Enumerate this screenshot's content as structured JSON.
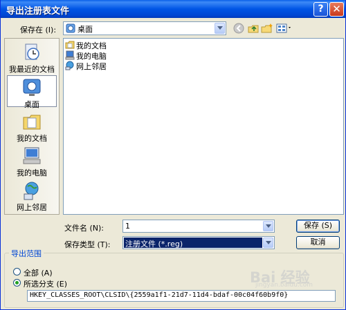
{
  "window": {
    "title": "导出注册表文件"
  },
  "look_in": {
    "label": "保存在 (I):",
    "value": "桌面"
  },
  "places": [
    {
      "label": "我最近的文档",
      "icon": "recent-documents-icon"
    },
    {
      "label": "桌面",
      "icon": "desktop-icon",
      "selected": true
    },
    {
      "label": "我的文档",
      "icon": "my-documents-icon"
    },
    {
      "label": "我的电脑",
      "icon": "my-computer-icon"
    },
    {
      "label": "网上邻居",
      "icon": "network-places-icon"
    }
  ],
  "files": [
    {
      "name": "我的文档",
      "icon": "folder-icon"
    },
    {
      "name": "我的电脑",
      "icon": "computer-icon"
    },
    {
      "name": "网上邻居",
      "icon": "network-icon"
    }
  ],
  "filename": {
    "label": "文件名 (N):",
    "value": "1"
  },
  "filetype": {
    "label": "保存类型 (T):",
    "value": "注册文件 (*.reg)"
  },
  "buttons": {
    "save": "保存 (S)",
    "cancel": "取消"
  },
  "export_range": {
    "title": "导出范围",
    "option_all": "全部 (A)",
    "option_branch": "所选分支 (E)",
    "branch_path": "HKEY_CLASSES_ROOT\\CLSID\\{2559a1f1-21d7-11d4-bdaf-00c04f60b9f0}"
  },
  "watermark": {
    "text": "Bai 经验",
    "sub": "jingyan.baidu.com"
  },
  "colors": {
    "title_bar": "#0055e5",
    "selection": "#0a246a",
    "group_title": "#0046d5"
  }
}
